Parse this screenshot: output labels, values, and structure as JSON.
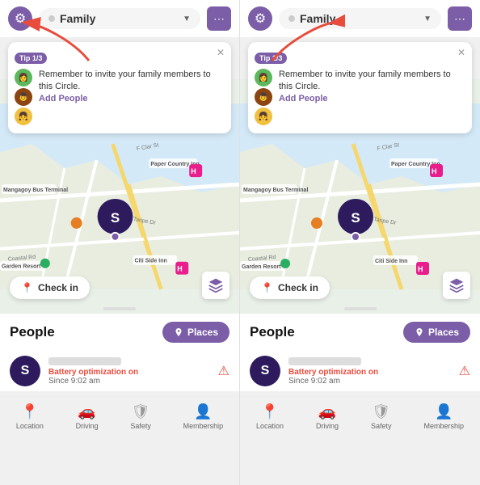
{
  "panels": [
    {
      "id": "panel-left",
      "header": {
        "family_label": "Family",
        "chevron": "▼",
        "gear_icon": "⚙",
        "chat_icon": "💬"
      },
      "tip": {
        "label": "Tip 1/3",
        "text": "Remember to invite your family members to this Circle.",
        "add_people_label": "Add People"
      },
      "map": {
        "user_initial": "S",
        "checkin_label": "Check in",
        "labels": [
          "Mangagoy Bus Terminal",
          "Paper Country Inn",
          "Taripe Dr",
          "Citi Side Inn",
          "Garden Resort",
          "F Clar St",
          "Coastal Rd"
        ]
      },
      "people_section": {
        "title": "People",
        "places_label": "Places",
        "person": {
          "initial": "S",
          "battery_text": "Battery optimization on",
          "since_text": "Since 9:02 am"
        }
      },
      "nav": {
        "items": [
          {
            "label": "Location",
            "icon": "📍"
          },
          {
            "label": "Driving",
            "icon": "🚗"
          },
          {
            "label": "Safety",
            "icon": "🛡"
          },
          {
            "label": "Membership",
            "icon": "👤"
          }
        ]
      }
    },
    {
      "id": "panel-right",
      "header": {
        "family_label": "Family",
        "chevron": "▼",
        "gear_icon": "⚙",
        "chat_icon": "💬"
      },
      "tip": {
        "label": "Tip 1/3",
        "text": "Remember to invite your family members to this Circle.",
        "add_people_label": "Add People"
      },
      "map": {
        "user_initial": "S",
        "checkin_label": "Check in",
        "labels": [
          "Mangagoy Bus Terminal",
          "Paper Country Inn",
          "Taripe Dr",
          "Citi Side Inn",
          "Garden Resort",
          "F Clar St",
          "Coastal Rd"
        ]
      },
      "people_section": {
        "title": "People",
        "places_label": "Places",
        "person": {
          "initial": "S",
          "battery_text": "Battery optimization on",
          "since_text": "Since 9:02 am"
        }
      },
      "nav": {
        "items": [
          {
            "label": "Location",
            "icon": "📍"
          },
          {
            "label": "Driving",
            "icon": "🚗"
          },
          {
            "label": "Safety",
            "icon": "🛡"
          },
          {
            "label": "Membership",
            "icon": "👤"
          }
        ]
      }
    }
  ],
  "colors": {
    "purple": "#7b5ea7",
    "dark_purple": "#2d1b5e",
    "red": "#e74c3c",
    "orange": "#e67e22"
  }
}
